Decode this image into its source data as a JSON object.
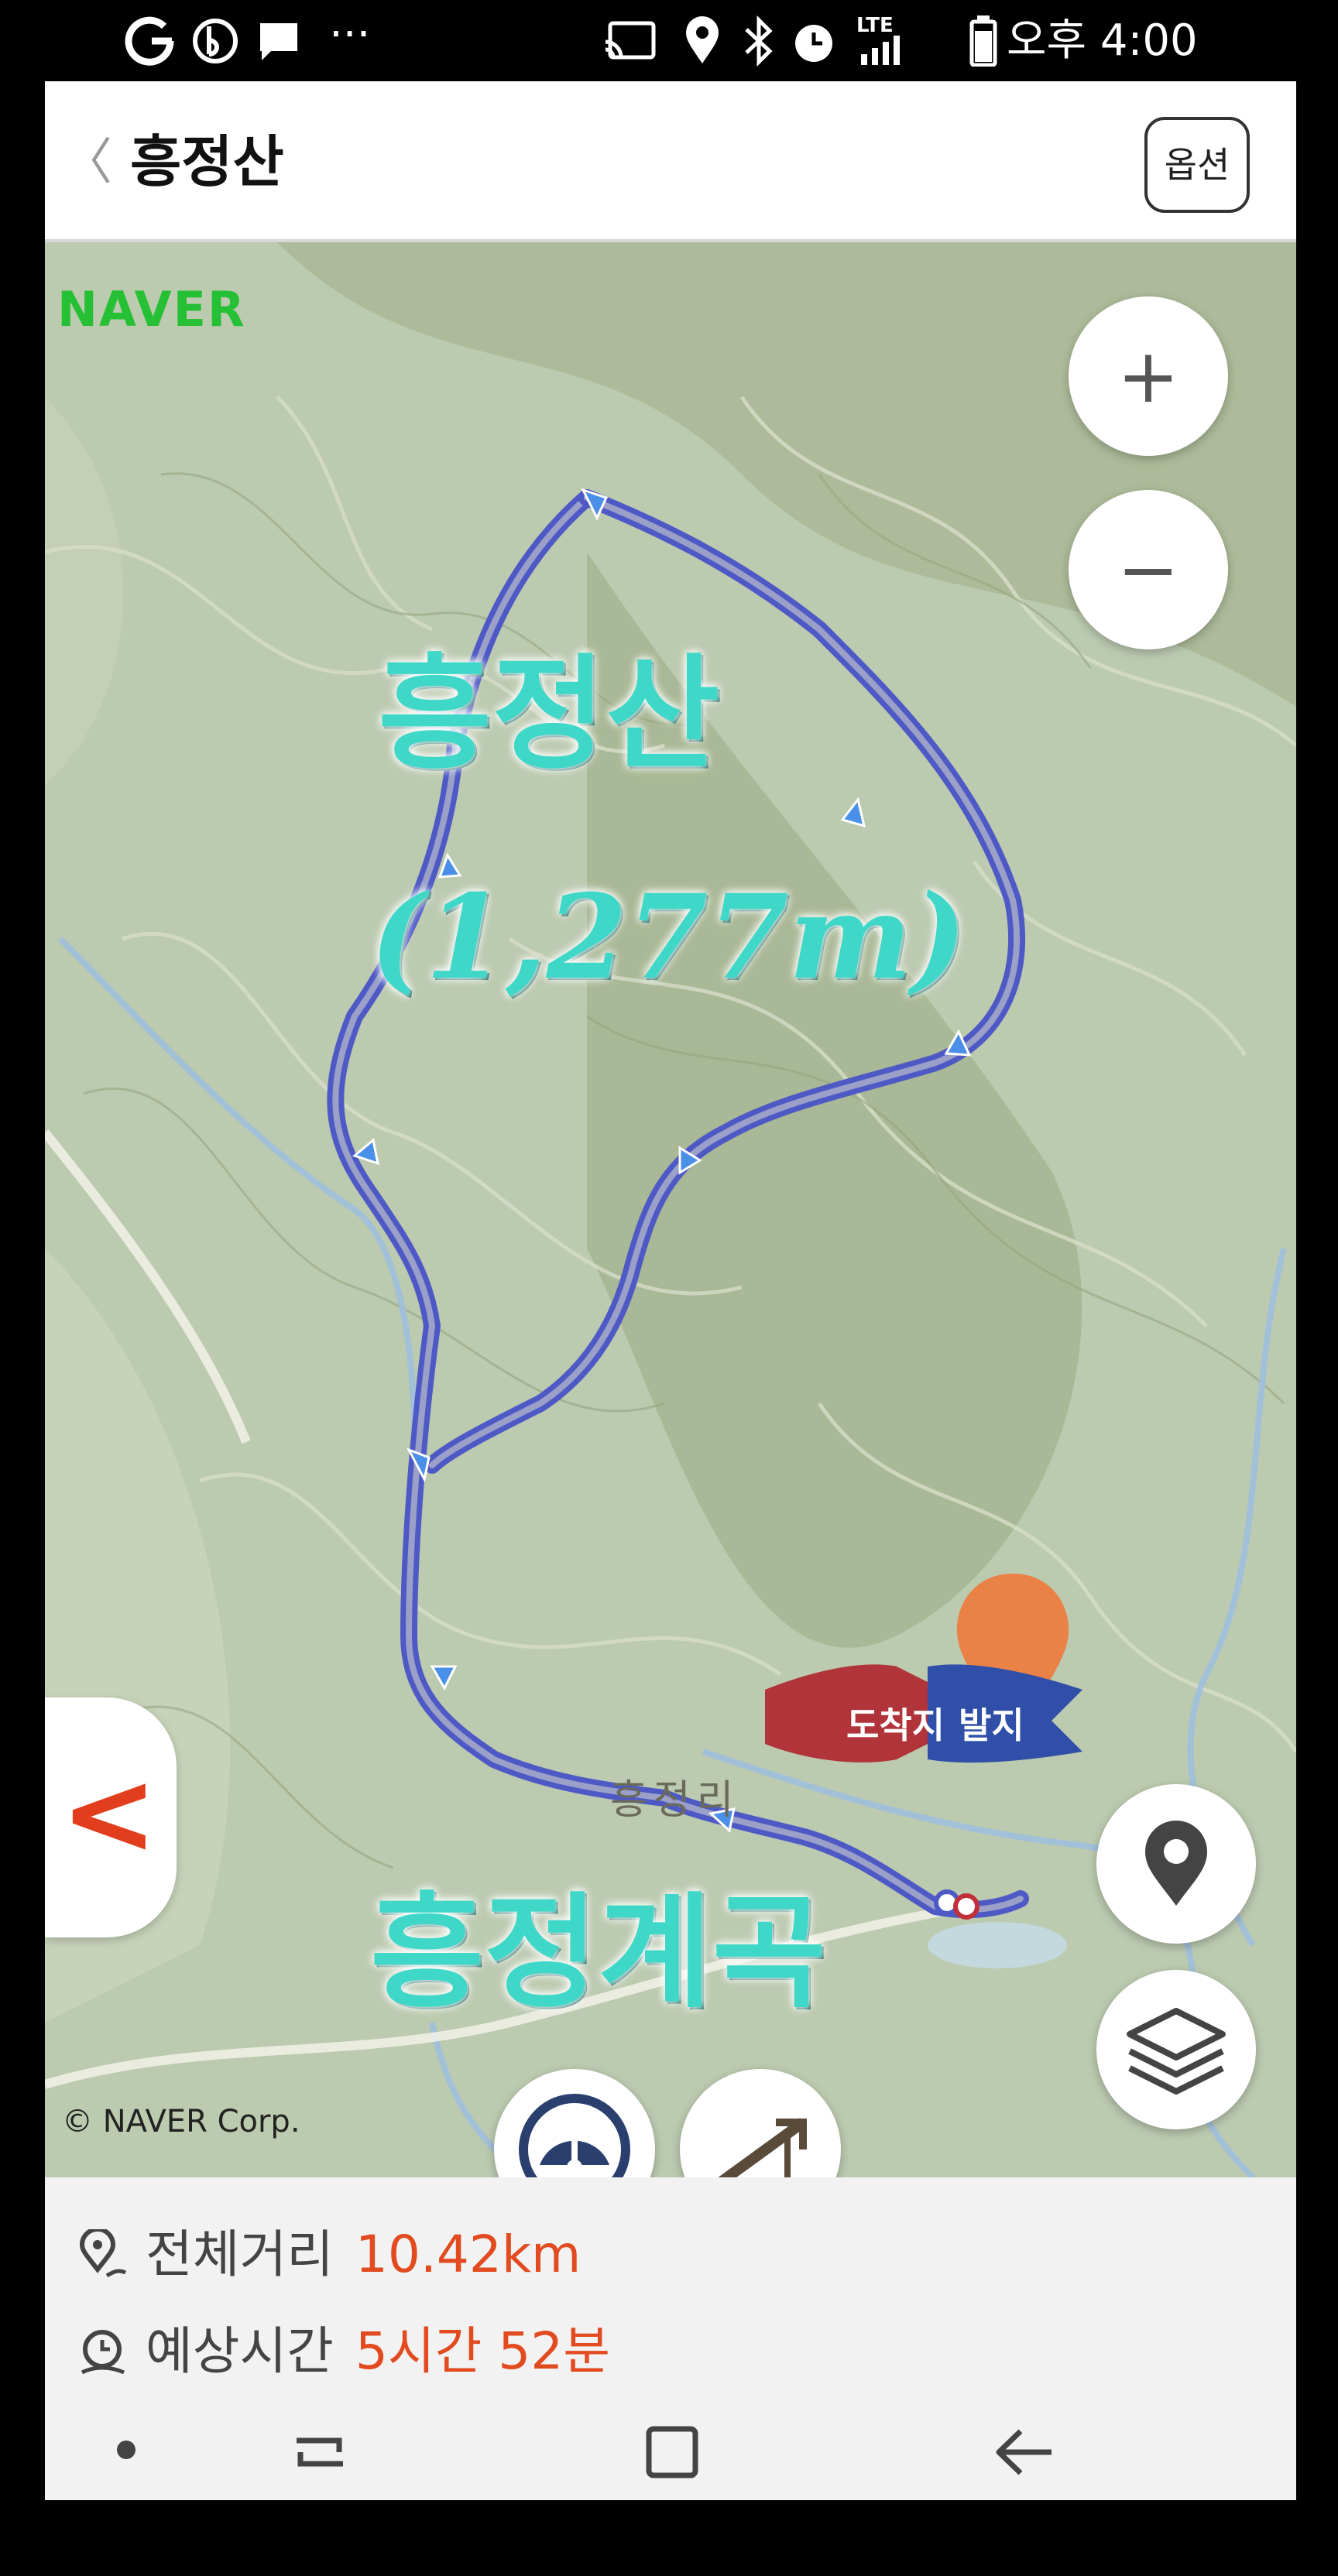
{
  "status_bar": {
    "left_icons": [
      "google-icon",
      "b-app-icon",
      "message-icon",
      "more-dots-icon"
    ],
    "more": "···",
    "right_icons": [
      "cast-icon",
      "location-icon",
      "bluetooth-icon",
      "alarm-icon",
      "lte-signal-icon",
      "battery-icon"
    ],
    "lte": "LTE",
    "time": "오후 4:00"
  },
  "header": {
    "back": "〈",
    "title": "흥정산",
    "option_label": "옵션"
  },
  "map": {
    "provider_logo": "NAVER",
    "copyright": "© NAVER Corp.",
    "overlay_mountain": "흥정산",
    "overlay_elevation": "(1,277m)",
    "overlay_valley": "흥정계곡",
    "village_label": "흥정리",
    "arrival_label": "도착지",
    "departure_label": "발지",
    "zoom_in": "+",
    "zoom_out": "−",
    "colors": {
      "route": "#5560c8",
      "map_bg": "#b9c7a7",
      "accent": "#e24a1f"
    }
  },
  "info": {
    "distance_label": "전체거리",
    "distance_value": "10.42km",
    "time_label": "예상시간",
    "time_value": "5시간 52분"
  },
  "nav": {
    "items": [
      "dot-icon",
      "recent-apps-icon",
      "home-icon",
      "back-icon"
    ]
  }
}
